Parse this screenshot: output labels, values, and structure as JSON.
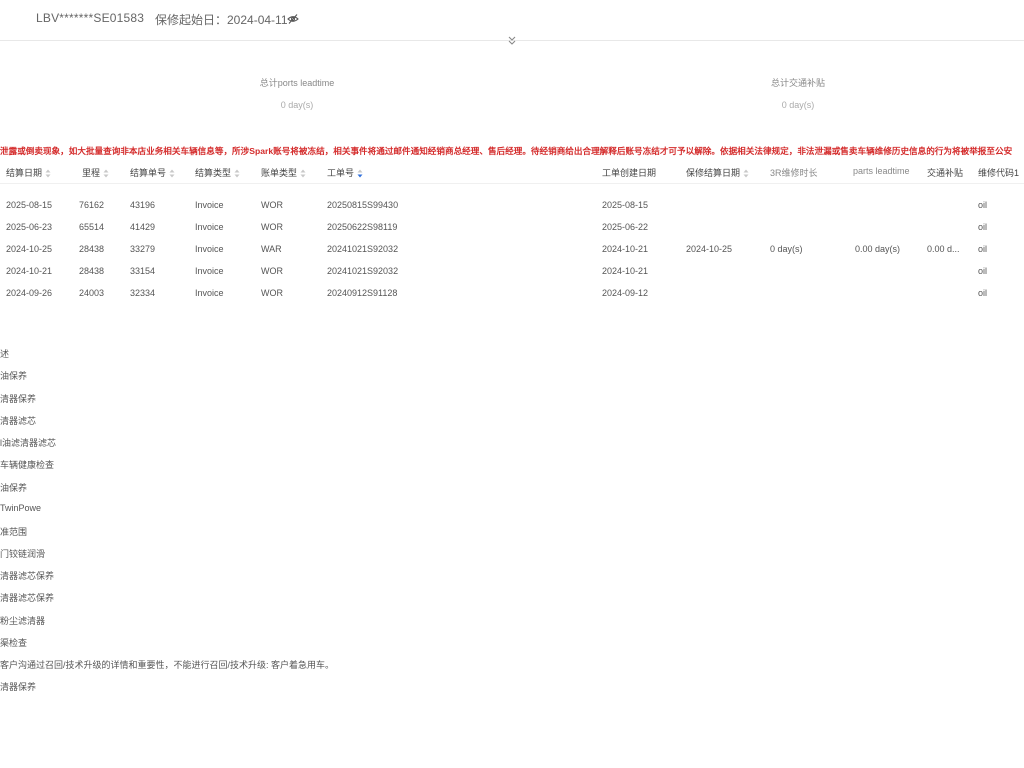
{
  "header": {
    "vin": "LBV*******SE01583",
    "warranty_start": "保修起始日：2024-04-11"
  },
  "totals": {
    "parts_leadtime_label": "总计ports leadtime",
    "parts_leadtime_value": "0 day(s)",
    "transport_subsidy_label": "总计交通补贴",
    "transport_subsidy_value": "0 day(s)"
  },
  "warning": "泄露或倒卖现象，如大批量查询非本店业务相关车辆信息等，所涉Spark账号将被冻结，相关事件将通过邮件通知经销商总经理、售后经理。待经销商给出合理解释后账号冻结才可予以解除。依据相关法律规定，非法泄漏或售卖车辆维修历史信息的行为将被举报至公安",
  "table": {
    "columns": {
      "settle_date": "结算日期",
      "mileage": "里程",
      "settle_no": "结算单号",
      "settle_type": "结算类型",
      "bill_type": "账单类型",
      "work_order_no": "工单号",
      "wo_create_date": "工单创建日期",
      "warranty_settle_date": "保修结算日期",
      "repair_duration": "3R维修时长",
      "parts_leadtime": "parts leadtime",
      "transport_subsidy": "交通补贴",
      "repair_code": "维修代码1"
    },
    "rows": [
      {
        "settle_date": "2025-08-15",
        "mileage": "76162",
        "settle_no": "43196",
        "settle_type": "Invoice",
        "bill_type": "WOR",
        "wo_no": "20250815S99430",
        "wo_date": "2025-08-15",
        "warranty_date": "",
        "repair_duration": "",
        "parts_leadtime": "",
        "transport": "",
        "code": "oil"
      },
      {
        "settle_date": "2025-06-23",
        "mileage": "65514",
        "settle_no": "41429",
        "settle_type": "Invoice",
        "bill_type": "WOR",
        "wo_no": "20250622S98119",
        "wo_date": "2025-06-22",
        "warranty_date": "",
        "repair_duration": "",
        "parts_leadtime": "",
        "transport": "",
        "code": "oil"
      },
      {
        "settle_date": "2024-10-25",
        "mileage": "28438",
        "settle_no": "33279",
        "settle_type": "Invoice",
        "bill_type": "WAR",
        "wo_no": "20241021S92032",
        "wo_date": "2024-10-21",
        "warranty_date": "2024-10-25",
        "repair_duration": "0 day(s)",
        "parts_leadtime": "0.00 day(s)",
        "transport": "0.00 d...",
        "code": "oil"
      },
      {
        "settle_date": "2024-10-21",
        "mileage": "28438",
        "settle_no": "33154",
        "settle_type": "Invoice",
        "bill_type": "WOR",
        "wo_no": "20241021S92032",
        "wo_date": "2024-10-21",
        "warranty_date": "",
        "repair_duration": "",
        "parts_leadtime": "",
        "transport": "",
        "code": "oil"
      },
      {
        "settle_date": "2024-09-26",
        "mileage": "24003",
        "settle_no": "32334",
        "settle_type": "Invoice",
        "bill_type": "WOR",
        "wo_no": "20240912S91128",
        "wo_date": "2024-09-12",
        "warranty_date": "",
        "repair_duration": "",
        "parts_leadtime": "",
        "transport": "",
        "code": "oil"
      }
    ]
  },
  "descriptions": [
    "述",
    "油保养",
    "清器保养",
    "清器滤芯",
    "l油滤清器滤芯",
    "车辆健康检查",
    "油保养",
    "TwinPowe",
    "准范围",
    "门铰链润滑",
    "清器滤芯保养",
    "清器滤芯保养",
    "粉尘滤清器",
    "渠检查",
    "客户沟通过召回/技术升级的详情和重要性，不能进行召回/技术升级: 客户着急用车。",
    "清器保养"
  ]
}
